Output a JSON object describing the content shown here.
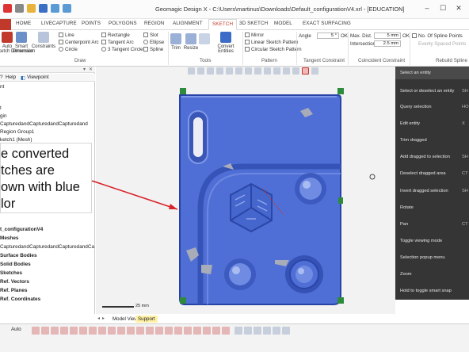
{
  "window": {
    "title": "Geomagic Design X - C:\\Users\\martinus\\Downloads\\Default_configurationV4.xrl - [EDUCATION]"
  },
  "tabs": [
    "HOME",
    "LIVECAPTURE",
    "POINTS",
    "POLYGONS",
    "REGION",
    "ALIGNMENT",
    "SKETCH",
    "3D SKETCH",
    "MODEL",
    "EXACT SURFACING"
  ],
  "ribbon": {
    "exit_label": "Auto\nSketch Dimension",
    "smart_dim": "Smart\nDimension",
    "constraints": "Constraints",
    "line": "Line",
    "centerpoint_arc": "Centerpoint Arc",
    "circle": "Circle",
    "rectangle": "Rectangle",
    "tangent_arc": "Tangent Arc",
    "three_tangent_circle": "3 Tangent Circle",
    "slot": "Slot",
    "ellipse": "Ellipse",
    "spline": "Spline",
    "trim": "Trim",
    "resize": "Resize",
    "convert_entities": "Convert\nEntities",
    "mirror": "Mirror",
    "linear_pattern": "Linear Sketch Pattern",
    "circular_pattern": "Circular Sketch Pattern",
    "angle_label": "Angle",
    "angle_value": "5 °",
    "ok1": "OK",
    "max_dist_label": "Max. Dist.",
    "max_dist_value": "5 mm",
    "ok2": "OK",
    "no_spline_points": "No. Of Spline Points",
    "intersection_label": "Intersection",
    "intersection_value": "2.5 mm",
    "evenly_spaced": "Evenly Spaced Points",
    "groups": [
      "Draw",
      "Tools",
      "Pattern",
      "Tangent Constraint",
      "Coincident Constraint",
      "Rebuild Spline"
    ]
  },
  "left_panel": {
    "help": "Help",
    "viewpoint": "Viewpoint",
    "tree_top": [
      "nt",
      "t",
      "gin",
      "CapturedandCapturedandCapturedand",
      "Region Group1",
      "ketch1 (Mesh)"
    ],
    "tree_bottom": [
      "t_configurationV4",
      "Meshes",
      "CapturedandCapturedandCapturedandCa",
      "Surface Bodies",
      "Solid Bodies",
      "Sketches",
      "Ref. Vectors",
      "Ref. Planes",
      "Ref. Coordinates"
    ]
  },
  "caption": {
    "lines": [
      "e converted",
      "tches are",
      "own with blue",
      "lor"
    ]
  },
  "viewport": {
    "scale_label": "25 mm"
  },
  "context_menu": {
    "items": [
      {
        "label": "Select an entity",
        "shortcut": ""
      },
      {
        "label": "Select or deselect an entity",
        "shortcut": "SH"
      },
      {
        "label": "Query selection",
        "shortcut": "HO"
      },
      {
        "label": "Edit entity",
        "shortcut": "X"
      },
      {
        "label": "Trim dragged",
        "shortcut": ""
      },
      {
        "label": "Add dragged to selection",
        "shortcut": "SH"
      },
      {
        "label": "Deselect dragged area",
        "shortcut": "CT"
      },
      {
        "label": "Invert dragged selection",
        "shortcut": "SH"
      },
      {
        "label": "Rotate",
        "shortcut": ""
      },
      {
        "label": "Pan",
        "shortcut": "CT"
      },
      {
        "label": "Toggle viewing mode",
        "shortcut": ""
      },
      {
        "label": "Selection popup menu",
        "shortcut": ""
      },
      {
        "label": "Zoom",
        "shortcut": ""
      },
      {
        "label": "Hold to toggle smart snap",
        "shortcut": ""
      }
    ]
  },
  "bottom_tabs": [
    "Model View",
    "Support"
  ],
  "status": {
    "auto": "Auto"
  },
  "colors": {
    "accent_red": "#c0392b",
    "part_blue": "#4f6fd6",
    "menu_bg": "#262626",
    "support_tab": "#fff2a8"
  }
}
